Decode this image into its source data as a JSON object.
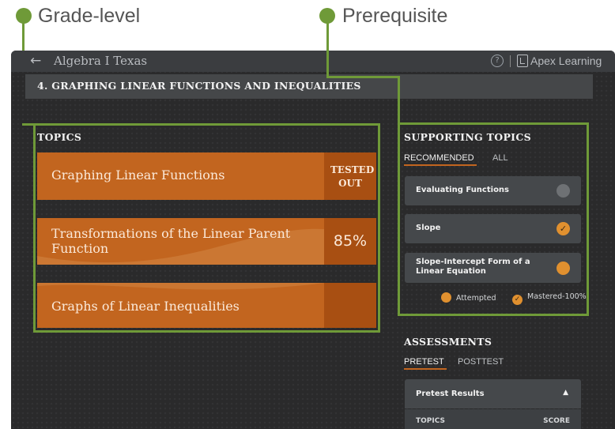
{
  "callouts": {
    "grade_level": "Grade-level",
    "prerequisite": "Prerequisite"
  },
  "colors": {
    "callout_green": "#6f9a38",
    "topic_orange": "#c2651f",
    "status_orange": "#a84f12",
    "mastery_orange": "#e0902f"
  },
  "header": {
    "back_icon": "left-arrow-icon",
    "course_title": "Algebra I Texas",
    "help_icon": "question-circle-icon",
    "brand": "Apex Learning"
  },
  "unit": {
    "title": "4. GRAPHING LINEAR FUNCTIONS AND INEQUALITIES"
  },
  "topics": {
    "heading": "TOPICS",
    "items": [
      {
        "name": "Graphing Linear Functions",
        "status": "TESTED OUT"
      },
      {
        "name": "Transformations of the Linear Parent Function",
        "status": "85%"
      },
      {
        "name": "Graphs of Linear Inequalities",
        "status": ""
      }
    ]
  },
  "supporting": {
    "heading": "SUPPORTING TOPICS",
    "tabs": [
      "RECOMMENDED",
      "ALL"
    ],
    "active_tab": "RECOMMENDED",
    "items": [
      {
        "name": "Evaluating Functions",
        "state": "not-started"
      },
      {
        "name": "Slope",
        "state": "mastered",
        "mark": "✓"
      },
      {
        "name": "Slope-Intercept Form of a Linear Equation",
        "state": "attempted"
      }
    ],
    "legend": {
      "attempted": "Attempted",
      "mastered": "Mastered-100%",
      "check": "✓"
    }
  },
  "assessments": {
    "heading": "ASSESSMENTS",
    "tabs": [
      "PRETEST",
      "POSTTEST"
    ],
    "active_tab": "PRETEST",
    "panel_title": "Pretest Results",
    "caret": "▲",
    "col_topics": "TOPICS",
    "col_score": "SCORE"
  }
}
